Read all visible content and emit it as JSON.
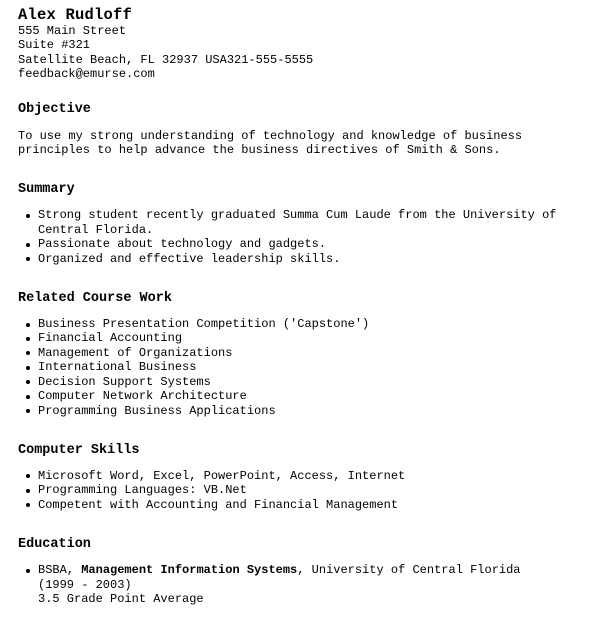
{
  "header": {
    "name": "Alex Rudloff",
    "address_line1": "555 Main Street",
    "address_line2": "Suite #321",
    "address_line3": "Satellite Beach, FL 32937 USA321-555-5555",
    "email": "feedback@emurse.com"
  },
  "objective": {
    "heading": "Objective",
    "text": "To use my strong understanding of technology and knowledge of business principles to help advance the business directives of Smith & Sons."
  },
  "summary": {
    "heading": "Summary",
    "items": [
      "Strong student recently graduated Summa Cum Laude from the University of Central Florida.",
      "Passionate about technology and gadgets.",
      "Organized and effective leadership skills."
    ]
  },
  "course_work": {
    "heading": "Related Course Work",
    "items": [
      "Business Presentation Competition ('Capstone')",
      "Financial Accounting",
      "Management of Organizations",
      "International Business",
      "Decision Support Systems",
      "Computer Network Architecture",
      "Programming Business Applications"
    ]
  },
  "computer_skills": {
    "heading": "Computer Skills",
    "items": [
      "Microsoft Word, Excel, PowerPoint, Access, Internet",
      "Programming Languages: VB.Net",
      "Competent with Accounting and Financial Management"
    ]
  },
  "education": {
    "heading": "Education",
    "degree": "BSBA, ",
    "major": "Management Information Systems",
    "school_dates": ", University of Central Florida (1999 - 2003)",
    "gpa": "3.5 Grade Point Average"
  }
}
